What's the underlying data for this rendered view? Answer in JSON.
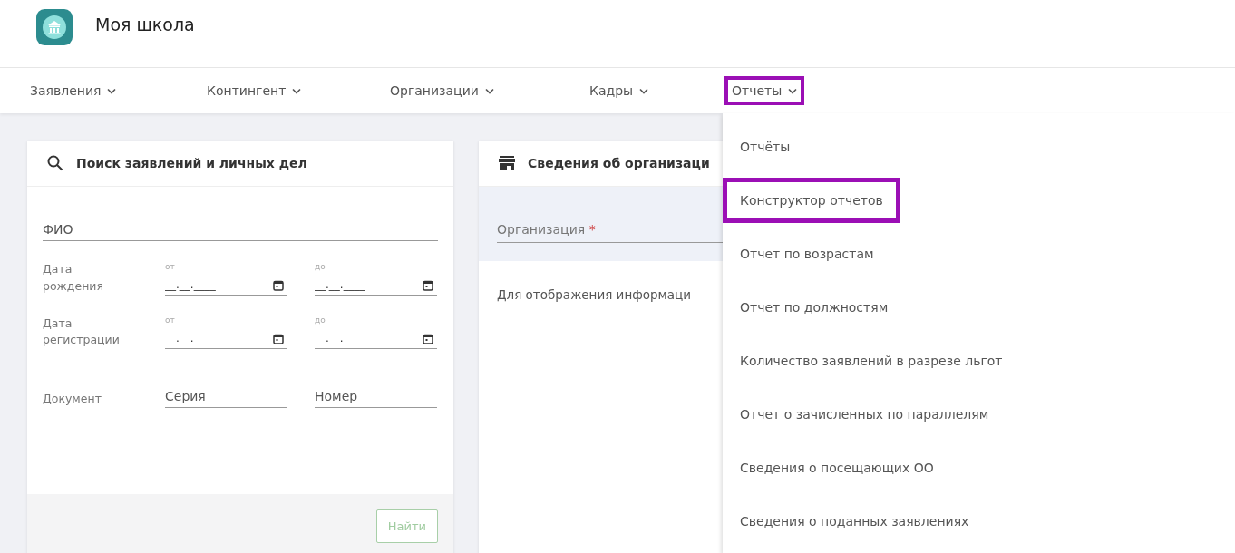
{
  "app": {
    "title": "Моя школа"
  },
  "nav": [
    {
      "label": "Заявления",
      "highlighted": false
    },
    {
      "label": "Контингент",
      "highlighted": false
    },
    {
      "label": "Организации",
      "highlighted": false
    },
    {
      "label": "Кадры",
      "highlighted": false
    },
    {
      "label": "Отчеты",
      "highlighted": true
    }
  ],
  "search_card": {
    "title": "Поиск заявлений и личных дел",
    "name_field": {
      "placeholder": "ФИО"
    },
    "date_rows": [
      {
        "label": "Дата рождения",
        "from": {
          "caption": "от",
          "placeholder": "__.__.____"
        },
        "to": {
          "caption": "до",
          "placeholder": "__.__.____"
        }
      },
      {
        "label": "Дата регистрации",
        "from": {
          "caption": "от",
          "placeholder": "__.__.____"
        },
        "to": {
          "caption": "до",
          "placeholder": "__.__.____"
        }
      }
    ],
    "document": {
      "label": "Документ",
      "series": {
        "placeholder": "Серия"
      },
      "number": {
        "placeholder": "Номер"
      }
    },
    "find_button": {
      "label": "Найти",
      "disabled": true
    }
  },
  "org_card": {
    "title": "Сведения об организаци",
    "field": {
      "label": "Организация",
      "required_mark": "*"
    },
    "hint": "Для отображения информаци"
  },
  "dropdown": [
    {
      "label": "Отчёты",
      "highlighted": false
    },
    {
      "label": "Конструктор отчетов",
      "highlighted": true
    },
    {
      "label": "Отчет по возрастам",
      "highlighted": false
    },
    {
      "label": "Отчет по должностям",
      "highlighted": false
    },
    {
      "label": "Количество заявлений в разрезе льгот",
      "highlighted": false
    },
    {
      "label": "Отчет о зачисленных по параллелям",
      "highlighted": false
    },
    {
      "label": "Сведения о посещающих ОО",
      "highlighted": false
    },
    {
      "label": "Сведения о поданных заявлениях",
      "highlighted": false
    }
  ]
}
